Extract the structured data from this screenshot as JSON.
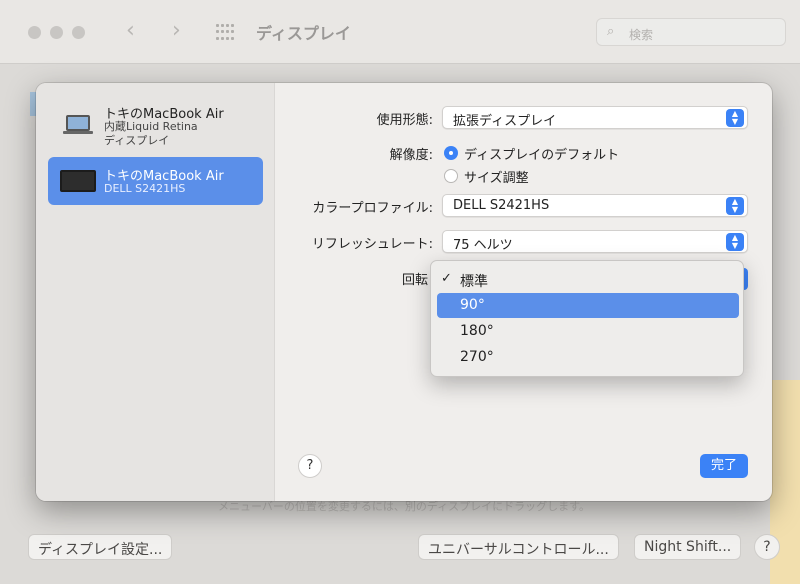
{
  "window": {
    "title": "ディスプレイ",
    "search_placeholder": "検索"
  },
  "background": {
    "note": "メニューバーの位置を変更するには、別のディスプレイにドラッグします。",
    "buttons": {
      "display_settings": "ディスプレイ設定...",
      "universal_control": "ユニバーサルコントロール...",
      "night_shift": "Night Shift...",
      "help": "?"
    }
  },
  "sidebar": {
    "displays": [
      {
        "name": "トキのMacBook Air",
        "sub1": "内蔵Liquid Retina",
        "sub2": "ディスプレイ",
        "selected": false,
        "icon": "laptop-icon"
      },
      {
        "name": "トキのMacBook Air",
        "sub1": "DELL S2421HS",
        "selected": true,
        "icon": "monitor-icon"
      }
    ]
  },
  "settings": {
    "usage": {
      "label": "使用形態:",
      "value": "拡張ディスプレイ"
    },
    "resolution": {
      "label": "解像度:",
      "options": [
        {
          "label": "ディスプレイのデフォルト",
          "selected": true
        },
        {
          "label": "サイズ調整",
          "selected": false
        }
      ]
    },
    "color_profile": {
      "label": "カラープロファイル:",
      "value": "DELL S2421HS"
    },
    "refresh_rate": {
      "label": "リフレッシュレート:",
      "value": "75 ヘルツ"
    },
    "rotation": {
      "label": "回転"
    }
  },
  "rotation_menu": {
    "items": [
      {
        "label": "標準",
        "checked": true,
        "highlighted": false
      },
      {
        "label": "90°",
        "checked": false,
        "highlighted": true
      },
      {
        "label": "180°",
        "checked": false,
        "highlighted": false
      },
      {
        "label": "270°",
        "checked": false,
        "highlighted": false
      }
    ],
    "check_mark": "✓"
  },
  "sheet_buttons": {
    "help": "?",
    "done": "完了"
  },
  "colors": {
    "accent": "#3b82f6",
    "selection": "#5b8fe9"
  }
}
